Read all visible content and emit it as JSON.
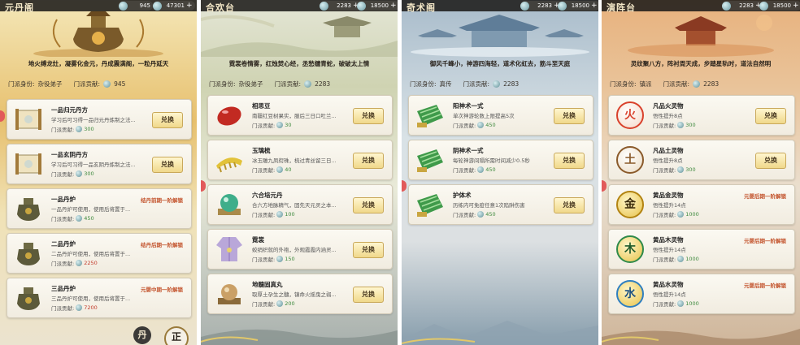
{
  "panels": [
    {
      "title": "元丹阁",
      "resources": [
        {
          "value": "945"
        },
        {
          "value": "47301"
        }
      ],
      "poem": "地火缚龙灶，凝雾化金元，丹成震满阁，一粒丹延天",
      "status": {
        "identity_label": "门派身份:",
        "identity_value": "杂役弟子",
        "contribution_label": "门派贡献:",
        "contribution_value": "945"
      },
      "items": [
        {
          "name": "一品归元丹方",
          "desc": "学习后可习得一品归元丹炼制之法...",
          "cost_label": "门派贡献:",
          "cost": "300",
          "button": "兑换",
          "icon": "scroll-icon"
        },
        {
          "name": "一品玄阴丹方",
          "desc": "学习后可习得一品玄阴丹炼制之法...",
          "cost_label": "门派贡献:",
          "cost": "300",
          "button": "兑换",
          "icon": "scroll-icon"
        },
        {
          "name": "一品丹炉",
          "desc": "一品丹炉可使用，使用后将置于...",
          "cost_label": "门派贡献:",
          "cost": "450",
          "lock": "结丹前期一阶解锁",
          "icon": "cauldron-icon"
        },
        {
          "name": "二品丹炉",
          "desc": "二品丹炉可使用，使用后将置于...",
          "cost_label": "门派贡献:",
          "cost": "2250",
          "lock": "结丹后期一阶解锁",
          "icon": "cauldron-icon"
        },
        {
          "name": "三品丹炉",
          "desc": "三品丹炉可使用，使用后将置于...",
          "cost_label": "门派贡献:",
          "cost": "7200",
          "lock": "元婴中期一阶解锁",
          "icon": "cauldron-icon"
        }
      ],
      "buttons": [
        {
          "label": "丹"
        },
        {
          "label": "正"
        }
      ]
    },
    {
      "title": "合欢台",
      "resources": [
        {
          "value": "2283"
        },
        {
          "value": "18500"
        }
      ],
      "poem": "霓裳卷情雾，红烛焚心经，丞愁缱青蛇，破破太上情",
      "status": {
        "identity_label": "门派身份:",
        "identity_value": "杂役弟子",
        "contribution_label": "门派贡献:",
        "contribution_value": "2283"
      },
      "items": [
        {
          "name": "相思豆",
          "desc": "南疆红豆树果实，服后三日口吐兰...",
          "cost_label": "门派贡献:",
          "cost": "30",
          "button": "兑换",
          "icon": "bean-icon"
        },
        {
          "name": "玉璃梳",
          "desc": "冰玉雕九凤衔珠，梳过青丝留三日...",
          "cost_label": "门派贡献:",
          "cost": "40",
          "button": "兑换",
          "icon": "comb-icon"
        },
        {
          "name": "六合培元丹",
          "desc": "合六方地脉精气，固先天元灵之本...",
          "cost_label": "门派贡献:",
          "cost": "100",
          "button": "兑换",
          "icon": "orb-icon"
        },
        {
          "name": "霓裳",
          "desc": "蛟绡织就的外袍，外观霞霞内涵灵...",
          "cost_label": "门派贡献:",
          "cost": "150",
          "button": "兑换",
          "icon": "robe-icon"
        },
        {
          "name": "地髓固真丸",
          "desc": "取厚土孕生之髓，镇命火摇曳之弱...",
          "cost_label": "门派贡献:",
          "cost": "200",
          "button": "兑换",
          "icon": "pill-icon"
        }
      ]
    },
    {
      "title": "奇术阁",
      "resources": [
        {
          "value": "2283"
        },
        {
          "value": "18500"
        }
      ],
      "poem": "御风千峰小，神游四海轻，道术化虹去，筋斗至天庭",
      "status": {
        "identity_label": "门派身份:",
        "identity_value": "真传",
        "contribution_label": "门派贡献:",
        "contribution_value": "2283"
      },
      "items": [
        {
          "name": "阳神术一式",
          "desc": "单次神游轮数上限提高5次",
          "cost_label": "门派贡献:",
          "cost": "450",
          "button": "兑换",
          "icon": "jade-book-icon"
        },
        {
          "name": "阴神术一式",
          "desc": "每轮神游间隔所需时间减少0.5秒",
          "cost_label": "门派贡献:",
          "cost": "450",
          "button": "兑换",
          "icon": "jade-book-icon"
        },
        {
          "name": "护体术",
          "desc": "历练内可免疫任意1次陷阱伤害",
          "cost_label": "门派贡献:",
          "cost": "450",
          "button": "兑换",
          "icon": "jade-book-icon"
        }
      ]
    },
    {
      "title": "演阵台",
      "resources": [
        {
          "value": "2283"
        },
        {
          "value": "18500"
        }
      ],
      "poem": "灵纹聚八方，阵衬周天成，步踏星轨时，道法自然明",
      "status": {
        "identity_label": "门派身份:",
        "identity_value": "镇派",
        "contribution_label": "门派贡献:",
        "contribution_value": "2283"
      },
      "items": [
        {
          "name": "凡品火灵物",
          "desc": "悟性提升8点",
          "cost_label": "门派贡献:",
          "cost": "300",
          "button": "兑换",
          "icon": "fire-element-icon",
          "glyph": "火",
          "color": "#d9412c"
        },
        {
          "name": "凡品土灵物",
          "desc": "悟性提升8点",
          "cost_label": "门派贡献:",
          "cost": "300",
          "button": "兑换",
          "icon": "earth-element-icon",
          "glyph": "土",
          "color": "#8a5a2a"
        },
        {
          "name": "黄品金灵物",
          "desc": "悟性提升14点",
          "cost_label": "门派贡献:",
          "cost": "1000",
          "lock": "元婴后期一阶解锁",
          "icon": "metal-element-icon",
          "glyph": "金",
          "color": "#c99a18"
        },
        {
          "name": "黄品木灵物",
          "desc": "悟性提升14点",
          "cost_label": "门派贡献:",
          "cost": "1000",
          "lock": "元婴后期一阶解锁",
          "icon": "wood-element-icon",
          "glyph": "木",
          "color": "#2f8a4a"
        },
        {
          "name": "黄品水灵物",
          "desc": "悟性提升14点",
          "cost_label": "门派贡献:",
          "cost": "1000",
          "lock": "元婴后期一阶解锁",
          "icon": "water-element-icon",
          "glyph": "水",
          "color": "#2f7fc0"
        }
      ]
    }
  ]
}
